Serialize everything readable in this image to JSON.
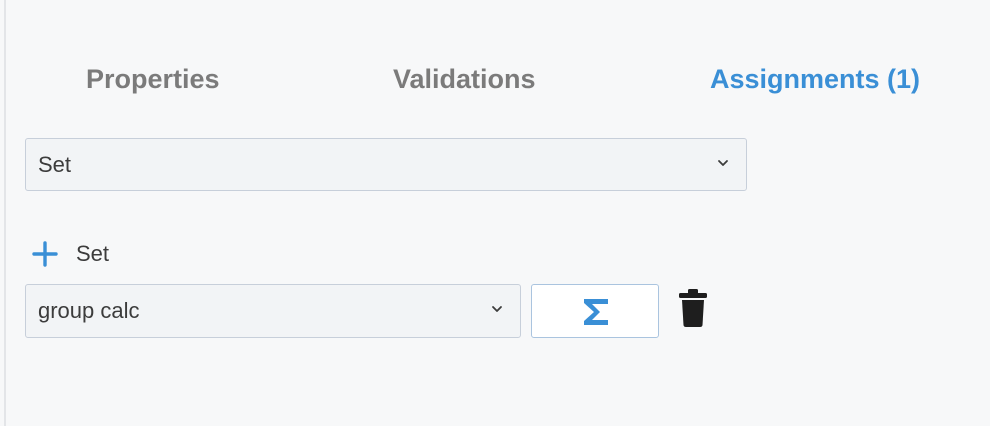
{
  "tabs": {
    "properties": "Properties",
    "validations": "Validations",
    "assignments": "Assignments (1)",
    "active": "assignments"
  },
  "type_select": {
    "value": "Set"
  },
  "add_action": {
    "label": "Set",
    "icon": "plus-icon"
  },
  "assignment": {
    "field_value": "group calc",
    "formula_icon": "sigma-icon",
    "delete_icon": "trash-icon"
  },
  "colors": {
    "accent": "#3a8fd6",
    "tab_inactive": "#7b7b7b",
    "text": "#3c3c3c",
    "background": "#f7f8f9"
  }
}
